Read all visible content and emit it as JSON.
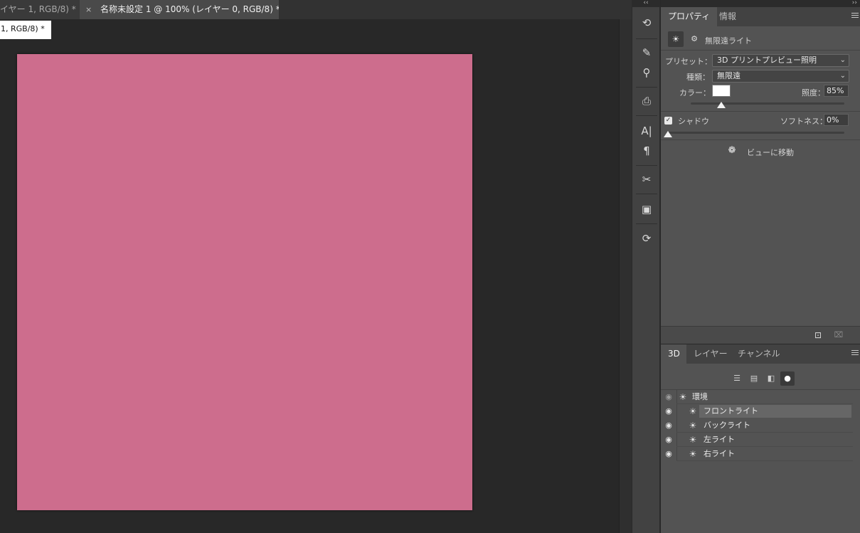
{
  "document_tabs": [
    {
      "label": "イヤー 1, RGB/8) *",
      "close": ""
    },
    {
      "label": "名称未設定 1 @ 100% (レイヤー 0, RGB/8) *",
      "close": "×"
    }
  ],
  "floating_window": {
    "title": "1, RGB/8) *"
  },
  "canvas": {
    "fill_color": "#cd6d8d"
  },
  "dock": {
    "collapse_glyph": "‹‹",
    "tools": [
      {
        "name": "history-brush-icon",
        "glyph": "⟲"
      },
      {
        "name": "brush-settings-icon",
        "glyph": "✎"
      },
      {
        "name": "tool-presets-icon",
        "glyph": "⚲"
      },
      {
        "name": "clone-source-icon",
        "glyph": "⎙"
      },
      {
        "name": "character-icon",
        "glyph": "A|"
      },
      {
        "name": "paragraph-icon",
        "glyph": "¶"
      },
      {
        "name": "3d-tools-icon",
        "glyph": "✂"
      },
      {
        "name": "navigator-icon",
        "glyph": "▣"
      },
      {
        "name": "history-icon",
        "glyph": "⟳"
      }
    ]
  },
  "properties_panel": {
    "expand_glyph": "››",
    "tabs": [
      "プロパティ",
      "情報"
    ],
    "header_icons": [
      "☀",
      "⚙"
    ],
    "light_type_title": "無限遠ライト",
    "preset_label": "プリセット：",
    "preset_value": "3D プリントプレビュー照明",
    "type_label": "種類：",
    "type_value": "無限遠",
    "color_label": "カラー：",
    "color_value": "#ffffff",
    "intensity_label": "照度：",
    "intensity_value": "85%",
    "intensity_level": 0.2,
    "shadow_label": "シャドウ",
    "shadow_checked": true,
    "softness_label": "ソフトネス：",
    "softness_value": "0%",
    "softness_level": 0.0,
    "move_to_view_label": "ビューに移動",
    "chevron": "⌄",
    "checkmark": "✓"
  },
  "panel_3d": {
    "tabs": [
      "3D",
      "レイヤー",
      "チャンネル"
    ],
    "filter_icons": [
      {
        "name": "scene-filter-icon",
        "glyph": "☰"
      },
      {
        "name": "mesh-filter-icon",
        "glyph": "▤"
      },
      {
        "name": "material-filter-icon",
        "glyph": "◧"
      },
      {
        "name": "light-filter-icon",
        "glyph": "●"
      }
    ],
    "tree": [
      {
        "label": "環境",
        "icon": "☀",
        "eye": "◉",
        "selected": false,
        "indent": 0
      },
      {
        "label": "フロントライト",
        "icon": "☀",
        "eye": "◉",
        "selected": true,
        "indent": 1
      },
      {
        "label": "バックライト",
        "icon": "☀",
        "eye": "◉",
        "selected": false,
        "indent": 1
      },
      {
        "label": "左ライト",
        "icon": "☀",
        "eye": "◉",
        "selected": false,
        "indent": 1
      },
      {
        "label": "右ライト",
        "icon": "☀",
        "eye": "◉",
        "selected": false,
        "indent": 1
      }
    ]
  },
  "bottom_icons": {
    "new": "⊡",
    "trash": "🗑"
  }
}
